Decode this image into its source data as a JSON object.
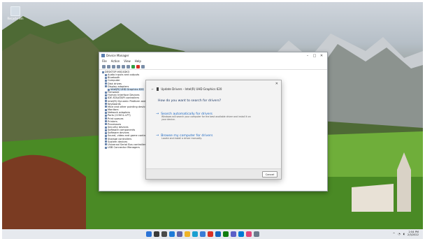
{
  "desktop": {
    "recycle_bin_label": "Recycle Bin"
  },
  "device_manager": {
    "title": "Device Manager",
    "menus": [
      "File",
      "Action",
      "View",
      "Help"
    ],
    "tree": [
      {
        "label": "DESKTOP-H8C4DK3",
        "indent": 0
      },
      {
        "label": "Audio inputs and outputs",
        "indent": 1
      },
      {
        "label": "Bluetooth",
        "indent": 1
      },
      {
        "label": "Computer",
        "indent": 1
      },
      {
        "label": "Disk drives",
        "indent": 1
      },
      {
        "label": "Display adapters",
        "indent": 1
      },
      {
        "label": "Intel(R) UHD Graphics 620",
        "indent": 2,
        "selected": true
      },
      {
        "label": "Firmware",
        "indent": 1
      },
      {
        "label": "Human Interface Devices",
        "indent": 1
      },
      {
        "label": "IDE ATA/ATAPI controllers",
        "indent": 1
      },
      {
        "label": "Intel(R) Dynamic Platform and Thermal Framework",
        "indent": 1
      },
      {
        "label": "Keyboards",
        "indent": 1
      },
      {
        "label": "Mice and other pointing devices",
        "indent": 1
      },
      {
        "label": "Monitors",
        "indent": 1
      },
      {
        "label": "Network adapters",
        "indent": 1
      },
      {
        "label": "Ports (COM & LPT)",
        "indent": 1
      },
      {
        "label": "Print queues",
        "indent": 1
      },
      {
        "label": "Printers",
        "indent": 1
      },
      {
        "label": "Processors",
        "indent": 1
      },
      {
        "label": "Security devices",
        "indent": 1
      },
      {
        "label": "Software components",
        "indent": 1
      },
      {
        "label": "Software devices",
        "indent": 1
      },
      {
        "label": "Sound, video and game controllers",
        "indent": 1
      },
      {
        "label": "Storage controllers",
        "indent": 1
      },
      {
        "label": "System devices",
        "indent": 1
      },
      {
        "label": "Universal Serial Bus controllers",
        "indent": 1
      },
      {
        "label": "USB Connector Managers",
        "indent": 1
      }
    ]
  },
  "dialog": {
    "header": "Update Drivers - Intel(R) UHD Graphics 620",
    "question": "How do you want to search for drivers?",
    "options": [
      {
        "title": "Search automatically for drivers",
        "desc": "Windows will search your computer for the best available driver and install it on your device."
      },
      {
        "title": "Browse my computer for drivers",
        "desc": "Locate and install a driver manually."
      }
    ],
    "cancel_label": "Cancel"
  },
  "taskbar": {
    "icons": [
      {
        "name": "start-icon",
        "color": "#2b73d6"
      },
      {
        "name": "search-icon",
        "color": "#3a3a3a"
      },
      {
        "name": "task-view-icon",
        "color": "#4a4a4a"
      },
      {
        "name": "widgets-icon",
        "color": "#1e7bd8"
      },
      {
        "name": "chat-icon",
        "color": "#6264a7"
      },
      {
        "name": "file-explorer-icon",
        "color": "#f0b429"
      },
      {
        "name": "edge-icon",
        "color": "#1a9fd0"
      },
      {
        "name": "store-icon",
        "color": "#3a7bd5"
      },
      {
        "name": "chrome-icon",
        "color": "#d93025"
      },
      {
        "name": "mail-icon",
        "color": "#1565c0"
      },
      {
        "name": "xbox-icon",
        "color": "#107c10"
      },
      {
        "name": "teams-icon",
        "color": "#5b5fc7"
      },
      {
        "name": "photos-icon",
        "color": "#0078d4"
      },
      {
        "name": "media-icon",
        "color": "#e0457b"
      },
      {
        "name": "device-manager-icon",
        "color": "#6b7a8c"
      }
    ],
    "time": "2:54 PM",
    "date": "2/3/2022"
  }
}
